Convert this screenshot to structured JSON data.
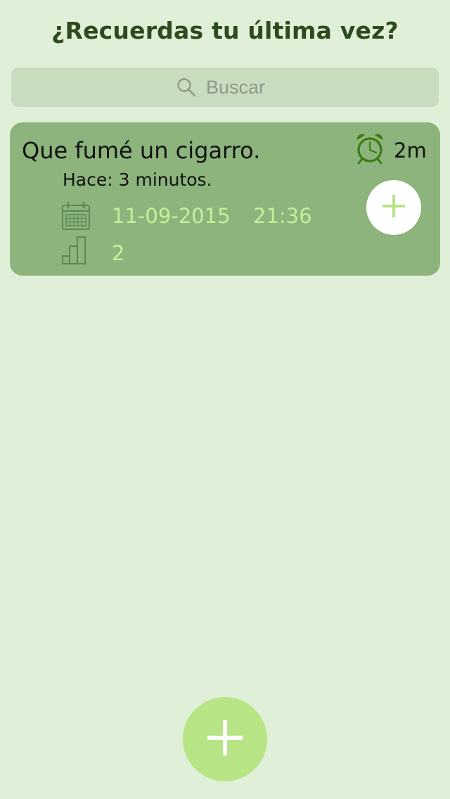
{
  "header": {
    "title": "¿Recuerdas tu última vez?"
  },
  "search": {
    "placeholder": "Buscar",
    "value": "",
    "icon": "search-icon"
  },
  "entries": [
    {
      "title": "Que fumé un cigarro.",
      "subtitle": "Hace: 3 minutos.",
      "elapsed": "2m",
      "date": "11-09-2015",
      "time": "21:36",
      "count": "2",
      "icons": {
        "alarm": "alarm-clock-icon",
        "calendar": "calendar-icon",
        "count": "bar-chart-icon",
        "add": "plus-icon"
      }
    }
  ],
  "fab": {
    "icon": "plus-icon"
  },
  "colors": {
    "background": "#e0f0d8",
    "card": "#8cb47c",
    "accent_text": "#c4f09a",
    "fab": "#b7e586",
    "icon_dark_green": "#3d7a12",
    "title": "#2e4a1f"
  }
}
